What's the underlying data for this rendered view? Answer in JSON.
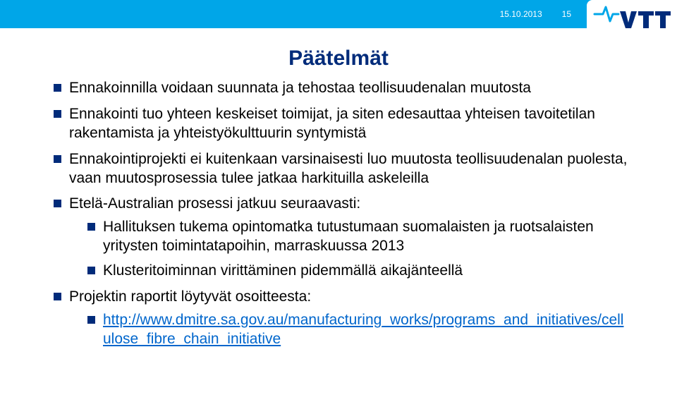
{
  "header": {
    "date": "15.10.2013",
    "page_number": "15",
    "logo_name": "VTT"
  },
  "title": "Päätelmät",
  "bullets": [
    {
      "text": "Ennakoinnilla voidaan suunnata ja tehostaa teollisuudenalan muutosta"
    },
    {
      "text": "Ennakointi tuo yhteen keskeiset toimijat, ja siten edesauttaa yhteisen tavoitetilan rakentamista ja yhteistyökulttuurin syntymistä"
    },
    {
      "text": "Ennakointiprojekti ei kuitenkaan varsinaisesti luo muutosta teollisuudenalan puolesta, vaan muutosprosessia tulee jatkaa harkituilla askeleilla"
    },
    {
      "text": "Etelä-Australian prosessi jatkuu seuraavasti:",
      "children": [
        {
          "text": "Hallituksen tukema opintomatka tutustumaan suomalaisten ja ruotsalaisten yritysten toimintatapoihin, marraskuussa 2013"
        },
        {
          "text": "Klusteritoiminnan virittäminen pidemmällä aikajänteellä"
        }
      ]
    },
    {
      "text": "Projektin raportit löytyvät osoitteesta:",
      "children": [
        {
          "link": "http://www.dmitre.sa.gov.au/manufacturing_works/programs_and_initiatives/cellulose_fibre_chain_initiative"
        }
      ]
    }
  ]
}
